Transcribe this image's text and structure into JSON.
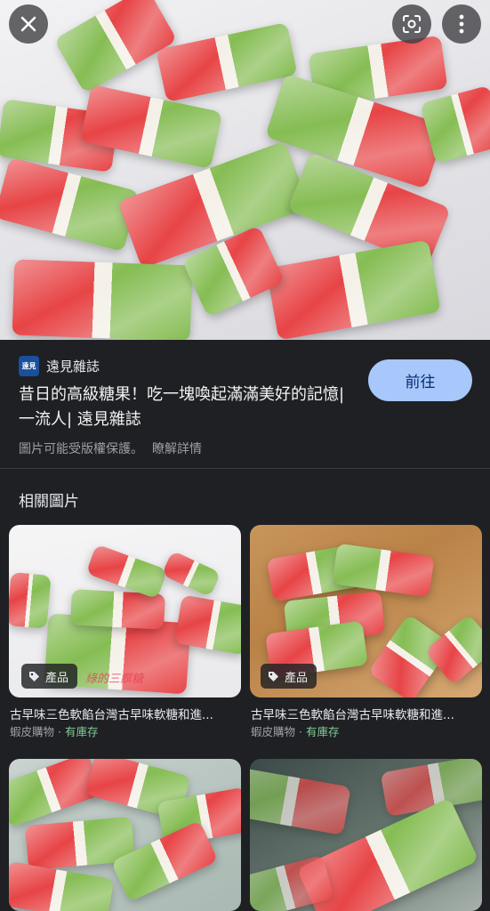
{
  "hero": {
    "image_alt": "三色軟糖"
  },
  "controls": {
    "close_icon": "close-icon",
    "lens_icon": "lens-icon",
    "more_icon": "more-vert-icon"
  },
  "source": {
    "logo_text": "遠見",
    "site_name": "遠見雜誌",
    "title": "昔日的高級糖果！吃一塊喚起滿滿美好的記憶| 一流人| 遠見雜誌",
    "visit_label": "前往",
    "copyright_note": "圖片可能受版權保護。",
    "learn_more": "瞭解詳情"
  },
  "related": {
    "heading": "相關圖片",
    "cards": [
      {
        "tag": "產品",
        "title": "古早味三色軟餡台灣古早味軟糖和進...",
        "store": "蝦皮購物",
        "stock": "有庫存",
        "watermark": "綠的三饌糖"
      },
      {
        "tag": "產品",
        "title": "古早味三色軟餡台灣古早味軟糖和進...",
        "store": "蝦皮購物",
        "stock": "有庫存"
      },
      {
        "tag": "",
        "title": "",
        "store": "",
        "stock": ""
      },
      {
        "tag": "",
        "title": "",
        "store": "",
        "stock": ""
      }
    ]
  },
  "colors": {
    "background": "#1f2023",
    "button": "#a8c7fa",
    "candy_red": "#e63a3c",
    "candy_green": "#7fb94a",
    "in_stock": "#81c995"
  }
}
